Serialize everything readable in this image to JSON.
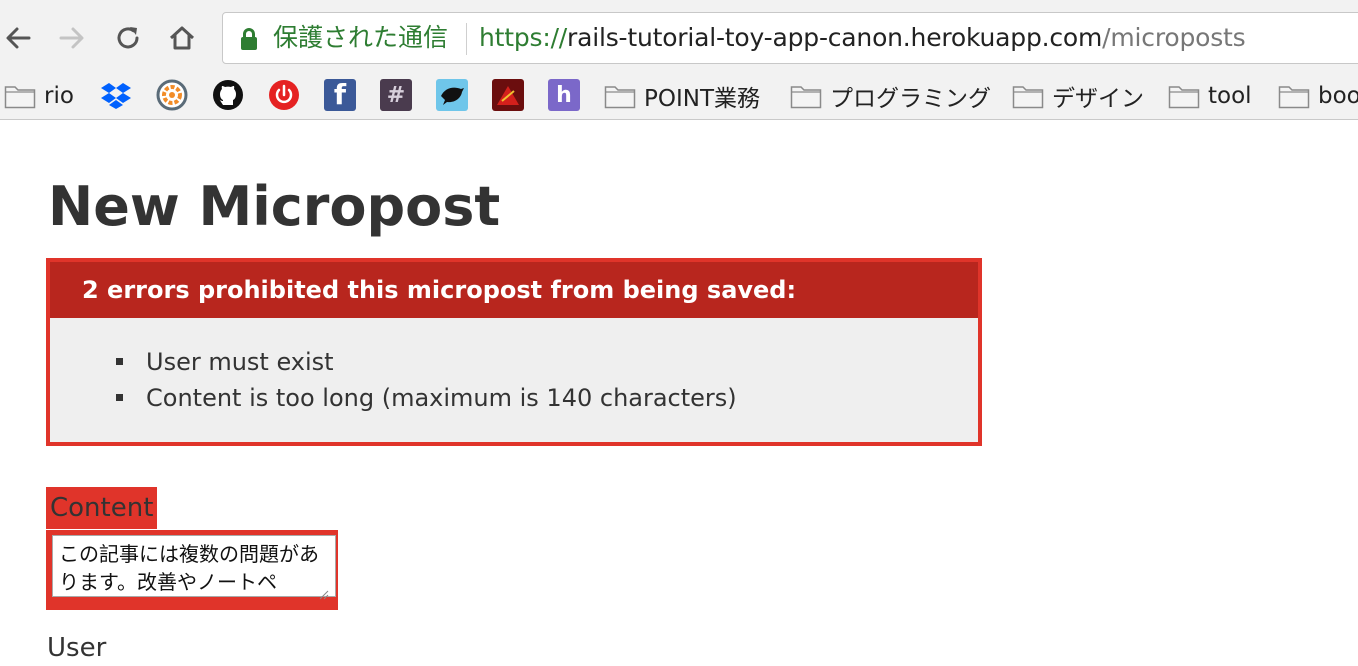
{
  "browser": {
    "security_label": "保護された通信",
    "url_scheme": "https://",
    "url_host": "rails-tutorial-toy-app-canon.herokuapp.com",
    "url_path": "/microposts"
  },
  "bookmarks": {
    "folders": [
      {
        "label": "rio"
      },
      {
        "label": "POINT業務"
      },
      {
        "label": "プログラミング"
      },
      {
        "label": "デザイン"
      },
      {
        "label": "tool"
      },
      {
        "label": "boo"
      }
    ],
    "icons": [
      "dropbox-icon",
      "orange-gear-icon",
      "github-icon",
      "power-icon",
      "facebook-icon",
      "slack-icon",
      "bird-icon",
      "red-app-icon",
      "heroku-icon"
    ],
    "colors": {
      "dropbox": "#0061fe",
      "facebook": "#3b5998",
      "slack": "#4a3b4e",
      "heroku": "#7b68c9",
      "power": "#e52222"
    }
  },
  "page": {
    "title": "New Micropost",
    "error": {
      "header": "2 errors prohibited this micropost from being saved:",
      "items": [
        "User must exist",
        "Content is too long (maximum is 140 characters)"
      ]
    },
    "content_label": "Content",
    "content_value": "この記事には複数の問題があります。改善やノートペ",
    "user_label": "User"
  },
  "colors": {
    "error_border": "#e0342a",
    "error_header": "#b8261e",
    "secure_green": "#2e7d32"
  }
}
